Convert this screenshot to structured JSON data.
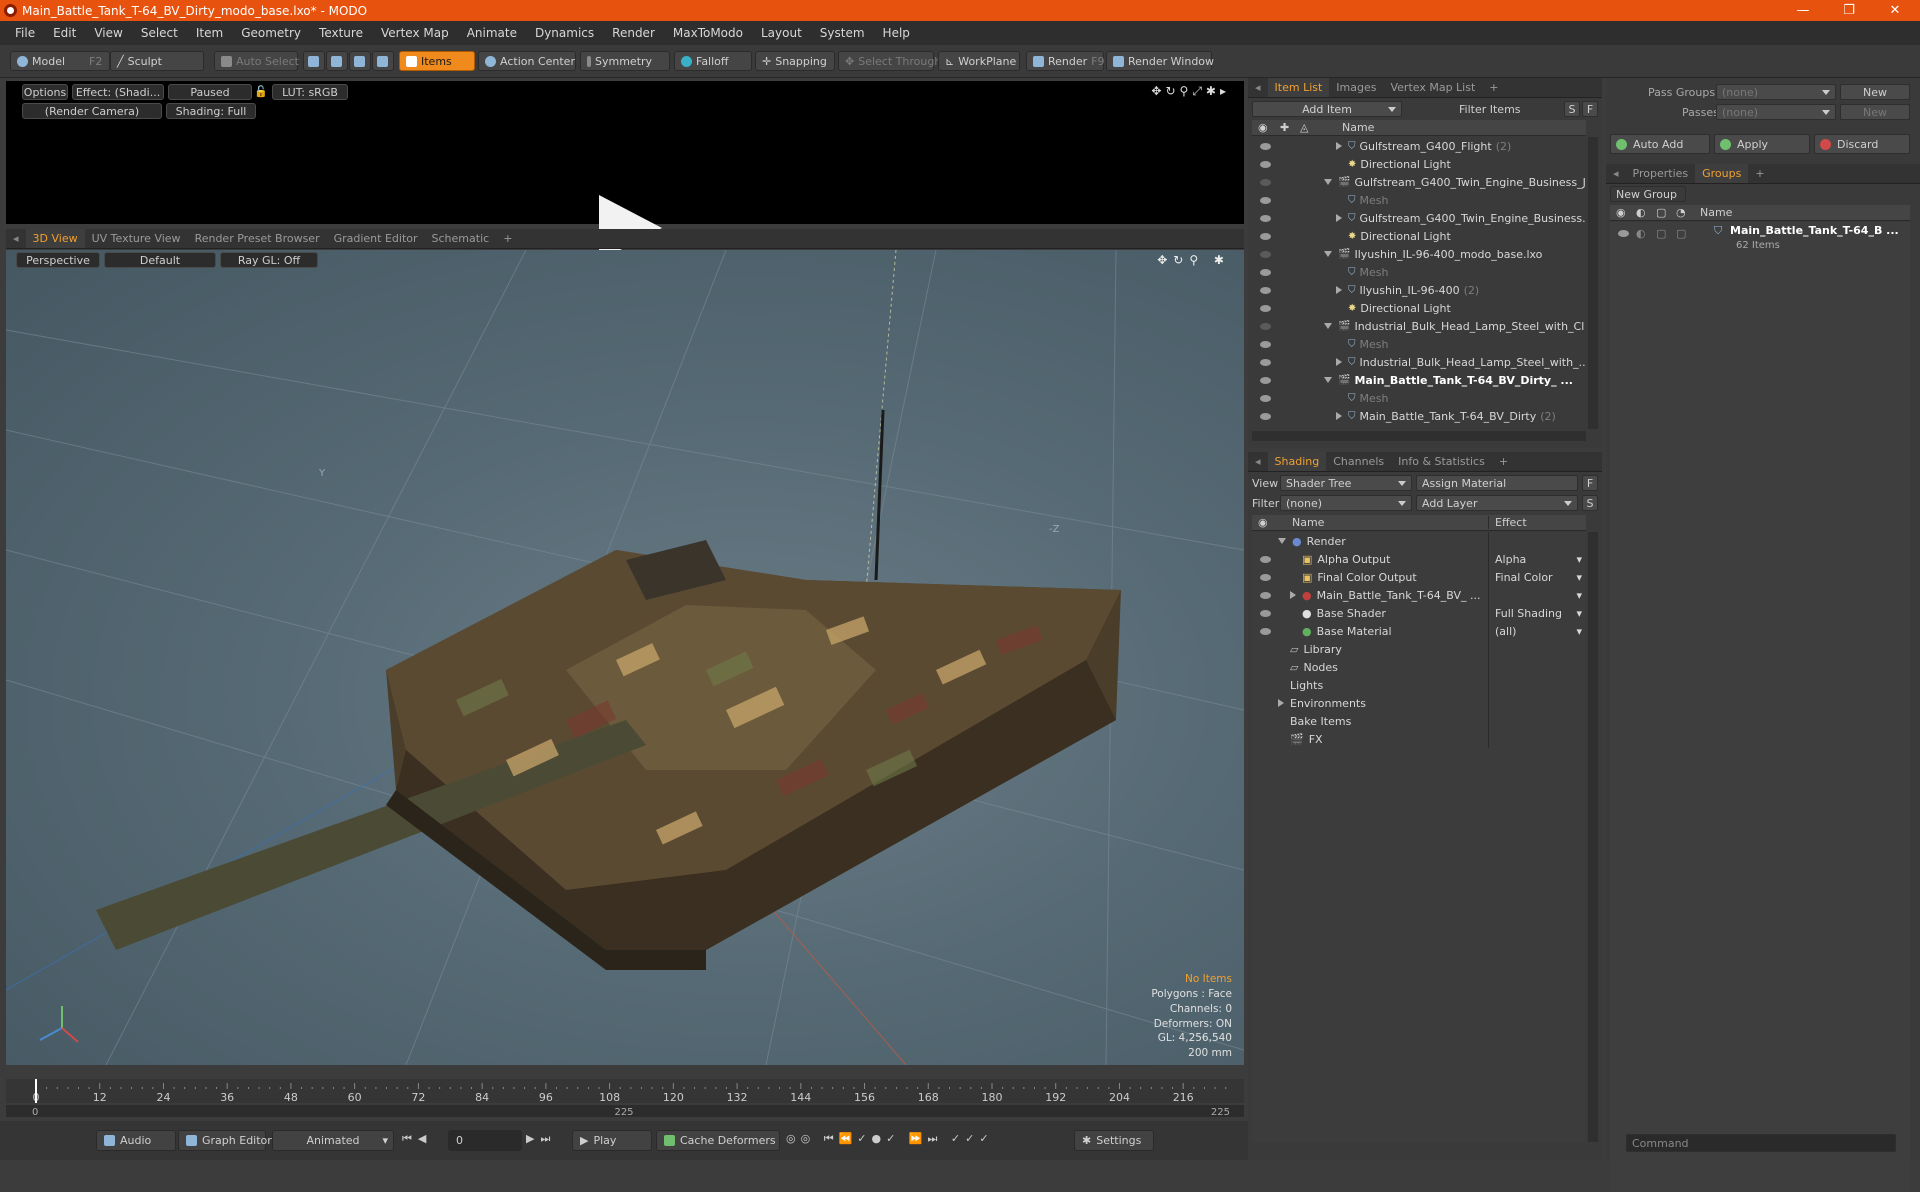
{
  "window": {
    "title": "Main_Battle_Tank_T-64_BV_Dirty_modo_base.lxo* - MODO",
    "controls": [
      "—",
      "❐",
      "✕"
    ]
  },
  "menu": [
    "File",
    "Edit",
    "View",
    "Select",
    "Item",
    "Geometry",
    "Texture",
    "Vertex Map",
    "Animate",
    "Dynamics",
    "Render",
    "MaxToModo",
    "Layout",
    "System",
    "Help"
  ],
  "toolbar": {
    "model": "Model",
    "model_key": "F2",
    "sculpt": "Sculpt",
    "auto_select": "Auto Select",
    "items": "Items",
    "action_center": "Action Center",
    "symmetry": "Symmetry",
    "falloff": "Falloff",
    "snapping": "Snapping",
    "select_through": "Select Through",
    "workplane": "WorkPlane",
    "render": "Render",
    "render_key": "F9",
    "render_window": "Render Window"
  },
  "preview": {
    "options": "Options",
    "effect": "Effect: (Shadi...",
    "paused": "Paused",
    "lut": "LUT: sRGB",
    "camera": "(Render Camera)",
    "shading": "Shading: Full"
  },
  "view_tabs": [
    "3D View",
    "UV Texture View",
    "Render Preset Browser",
    "Gradient Editor",
    "Schematic"
  ],
  "viewport": {
    "projection": "Perspective",
    "style": "Default",
    "raygl": "Ray GL: Off",
    "axis_y": "Y",
    "axis_neg_z": "-Z",
    "info": {
      "selection": "No Items",
      "polygons": "Polygons : Face",
      "channels": "Channels: 0",
      "deformers": "Deformers: ON",
      "gl": "GL: 4,256,540",
      "scale": "200 mm"
    }
  },
  "timeline": {
    "ticks": [
      "0",
      "12",
      "24",
      "36",
      "48",
      "60",
      "72",
      "84",
      "96",
      "108",
      "120",
      "132",
      "144",
      "156",
      "168",
      "180",
      "192",
      "204",
      "216"
    ],
    "range_start": "0",
    "range_mid": "225",
    "range_end": "225"
  },
  "bottom": {
    "audio": "Audio",
    "graph_editor": "Graph Editor",
    "animated": "Animated",
    "frame": "0",
    "play": "Play",
    "cache_deformers": "Cache Deformers",
    "settings": "Settings"
  },
  "itemlist": {
    "tabs": [
      "Item List",
      "Images",
      "Vertex Map List"
    ],
    "add_item": "Add Item",
    "filter": "Filter Items",
    "s": "S",
    "f": "F",
    "col_name": "Name",
    "rows": [
      {
        "label": "Gulfstream_G400_Flight",
        "count": "(2)",
        "indent": 2,
        "arrow": "right",
        "kind": "mesh",
        "eye": true
      },
      {
        "label": "Directional Light",
        "indent": 2,
        "arrow": "none",
        "kind": "light",
        "eye": true
      },
      {
        "label": "Gulfstream_G400_Twin_Engine_Business_J...",
        "indent": 1,
        "arrow": "down",
        "kind": "scene",
        "eye": false
      },
      {
        "label": "Mesh",
        "indent": 2,
        "arrow": "none",
        "kind": "mesh",
        "eye": true,
        "dim": true
      },
      {
        "label": "Gulfstream_G400_Twin_Engine_Business...",
        "indent": 2,
        "arrow": "right",
        "kind": "mesh",
        "eye": true
      },
      {
        "label": "Directional Light",
        "indent": 2,
        "arrow": "none",
        "kind": "light",
        "eye": true
      },
      {
        "label": "Ilyushin_IL-96-400_modo_base.lxo",
        "indent": 1,
        "arrow": "down",
        "kind": "scene",
        "eye": false
      },
      {
        "label": "Mesh",
        "indent": 2,
        "arrow": "none",
        "kind": "mesh",
        "eye": true,
        "dim": true
      },
      {
        "label": "Ilyushin_IL-96-400",
        "count": "(2)",
        "indent": 2,
        "arrow": "right",
        "kind": "mesh",
        "eye": true
      },
      {
        "label": "Directional Light",
        "indent": 2,
        "arrow": "none",
        "kind": "light",
        "eye": true
      },
      {
        "label": "Industrial_Bulk_Head_Lamp_Steel_with_Cl ...",
        "indent": 1,
        "arrow": "down",
        "kind": "scene",
        "eye": false
      },
      {
        "label": "Mesh",
        "indent": 2,
        "arrow": "none",
        "kind": "mesh",
        "eye": true,
        "dim": true
      },
      {
        "label": "Industrial_Bulk_Head_Lamp_Steel_with_...",
        "indent": 2,
        "arrow": "right",
        "kind": "mesh",
        "eye": true
      },
      {
        "label": "Main_Battle_Tank_T-64_BV_Dirty_ ...",
        "indent": 1,
        "arrow": "down",
        "kind": "scene",
        "eye": true,
        "bold": true
      },
      {
        "label": "Mesh",
        "indent": 2,
        "arrow": "none",
        "kind": "mesh",
        "eye": true,
        "dim": true
      },
      {
        "label": "Main_Battle_Tank_T-64_BV_Dirty",
        "count": "(2)",
        "indent": 2,
        "arrow": "right",
        "kind": "mesh",
        "eye": true
      }
    ]
  },
  "shading": {
    "tabs": [
      "Shading",
      "Channels",
      "Info & Statistics"
    ],
    "view_label": "View",
    "view_value": "Shader Tree",
    "assign": "Assign Material",
    "filter_label": "Filter",
    "filter_value": "(none)",
    "add_layer": "Add Layer",
    "f": "F",
    "s": "S",
    "col_name": "Name",
    "col_effect": "Effect",
    "rows": [
      {
        "label": "Render",
        "effect": "",
        "indent": 0,
        "arrow": "down",
        "icon": "render",
        "eye": false
      },
      {
        "label": "Alpha Output",
        "effect": "Alpha",
        "indent": 1,
        "arrow": "none",
        "icon": "output",
        "eye": true
      },
      {
        "label": "Final Color Output",
        "effect": "Final Color",
        "indent": 1,
        "arrow": "none",
        "icon": "output",
        "eye": true
      },
      {
        "label": "Main_Battle_Tank_T-64_BV_ ...",
        "effect": "",
        "indent": 1,
        "arrow": "right",
        "icon": "material",
        "eye": true
      },
      {
        "label": "Base Shader",
        "effect": "Full Shading",
        "indent": 1,
        "arrow": "none",
        "icon": "shader",
        "eye": true
      },
      {
        "label": "Base Material",
        "effect": "(all)",
        "indent": 1,
        "arrow": "none",
        "icon": "basemat",
        "eye": true
      },
      {
        "label": "Library",
        "effect": "",
        "indent": 0,
        "arrow": "none",
        "icon": "folder",
        "eye": false
      },
      {
        "label": "Nodes",
        "effect": "",
        "indent": 0,
        "arrow": "none",
        "icon": "folder",
        "eye": false
      },
      {
        "label": "Lights",
        "effect": "",
        "indent": 0,
        "arrow": "none",
        "icon": "none",
        "eye": false
      },
      {
        "label": "Environments",
        "effect": "",
        "indent": 0,
        "arrow": "right",
        "icon": "none",
        "eye": false
      },
      {
        "label": "Bake Items",
        "effect": "",
        "indent": 0,
        "arrow": "none",
        "icon": "none",
        "eye": false
      },
      {
        "label": "FX",
        "effect": "",
        "indent": 0,
        "arrow": "none",
        "icon": "fx",
        "eye": false
      }
    ]
  },
  "right": {
    "pass_groups": "Pass Groups",
    "pass_groups_value": "(none)",
    "passes": "Passes",
    "passes_value": "(none)",
    "new": "New",
    "new2": "New",
    "auto_add": "Auto Add",
    "apply": "Apply",
    "discard": "Discard",
    "tabs": [
      "Properties",
      "Groups"
    ],
    "new_group": "New Group",
    "col_name": "Name",
    "group_name": "Main_Battle_Tank_T-64_B ...",
    "group_count": "62 Items",
    "command_placeholder": "Command"
  },
  "colors": {
    "accent": "#f08a1c",
    "titlebar": "#e8520f",
    "tab_active": "#f0a030"
  }
}
